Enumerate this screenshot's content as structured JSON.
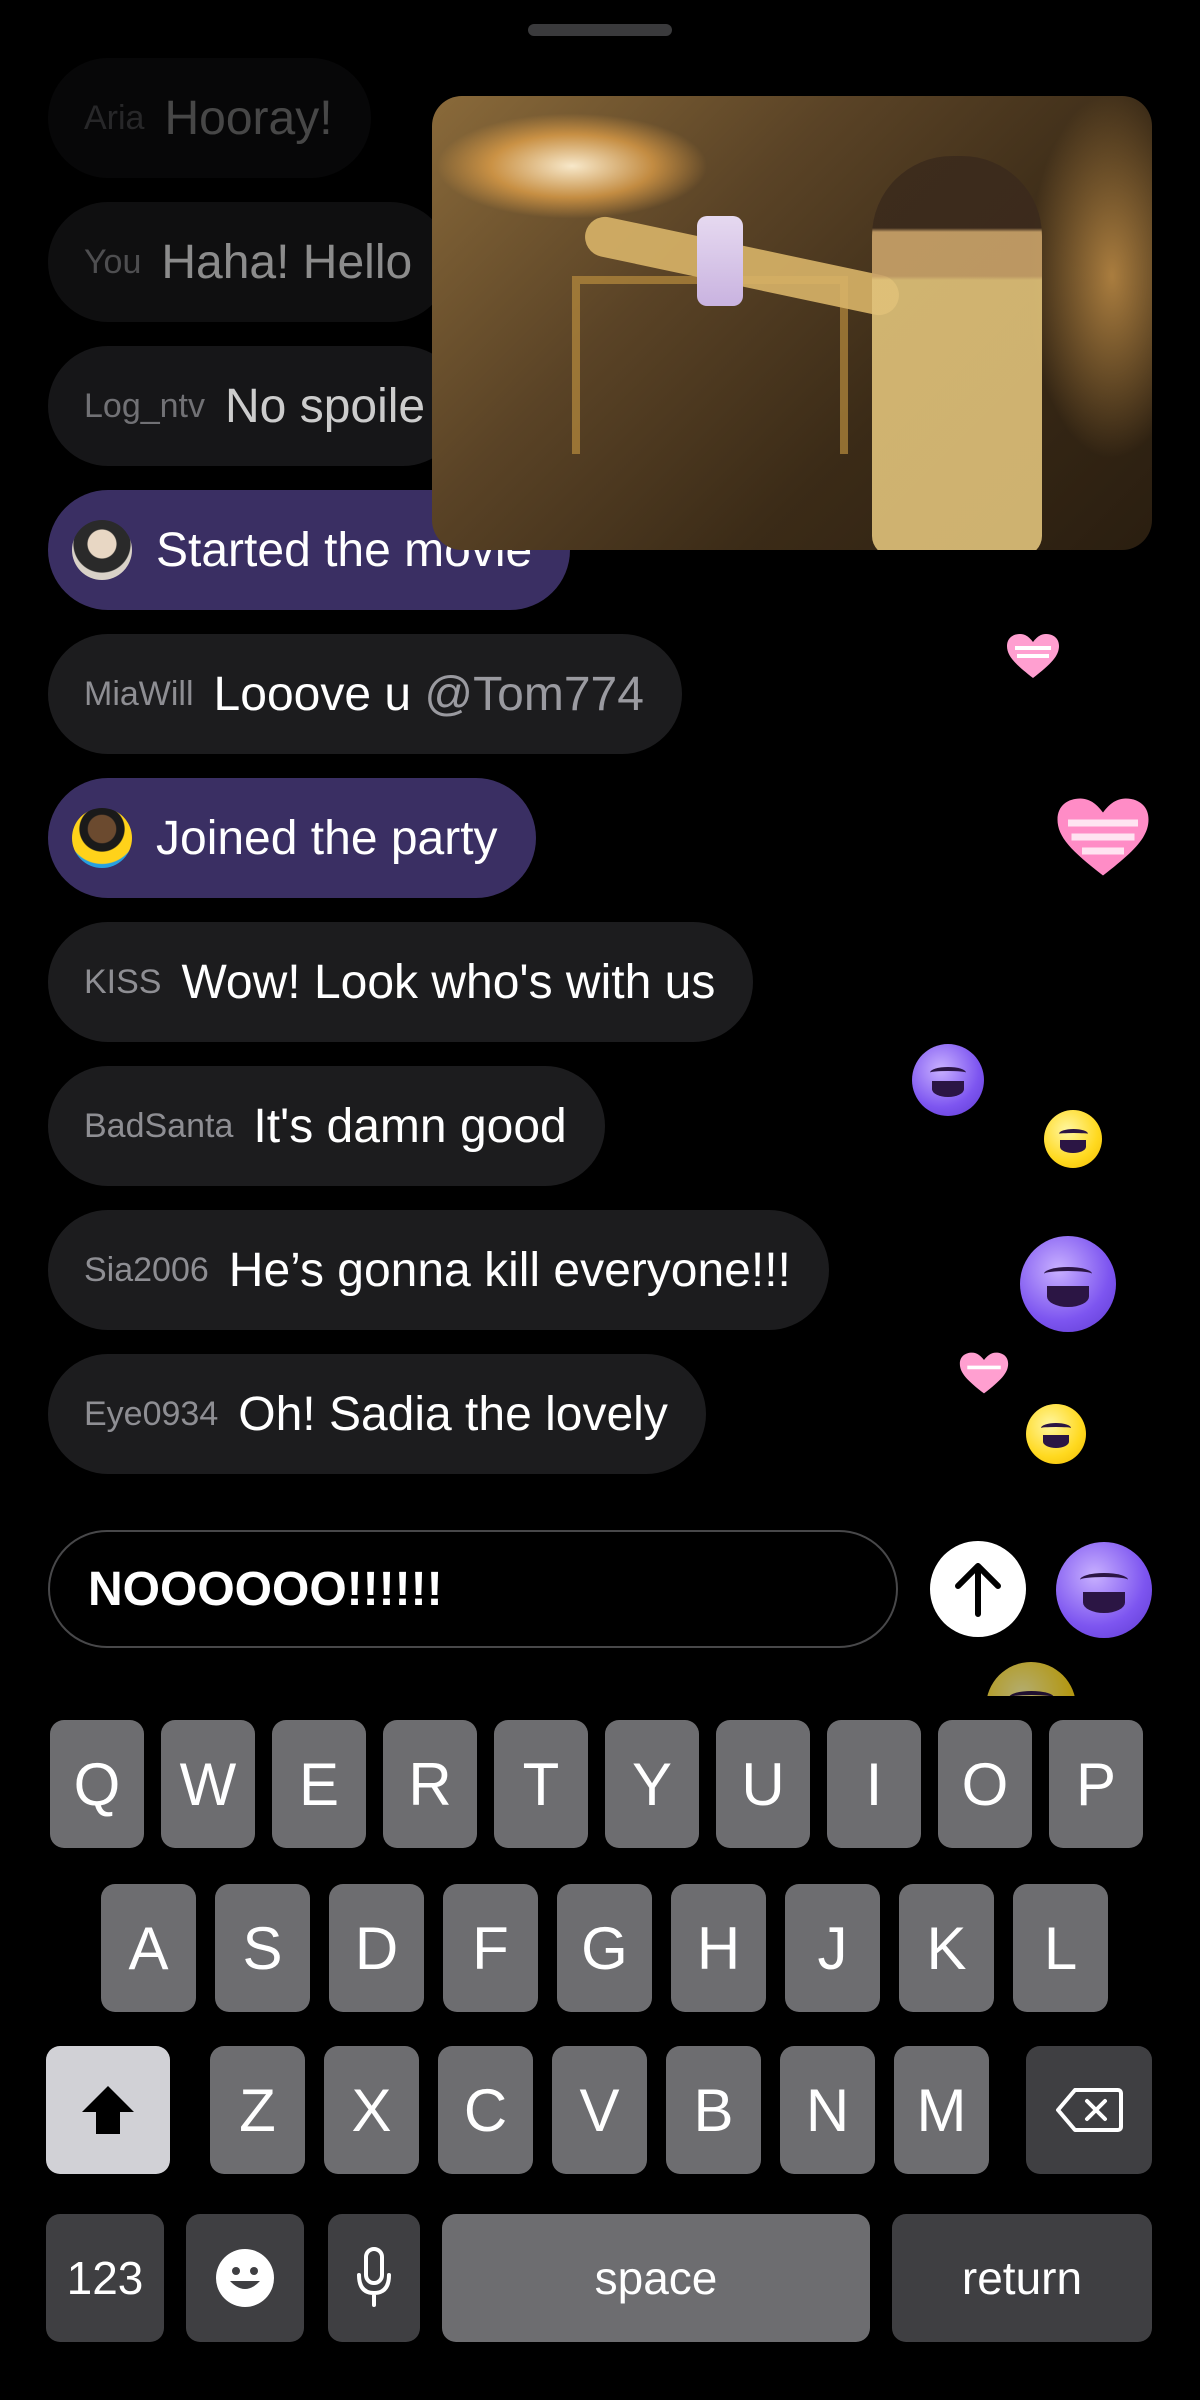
{
  "chat": {
    "messages": [
      {
        "user": "Aria",
        "text": "Hooray!"
      },
      {
        "user": "You",
        "text": "Haha! Hello"
      },
      {
        "user": "Log_ntv",
        "text": "No spoile"
      },
      {
        "user": "",
        "text": "Started the movie",
        "system": true
      },
      {
        "user": "MiaWill",
        "text": "Looove u",
        "mention": "@Tom774"
      },
      {
        "user": "",
        "text": "Joined the party",
        "system": true
      },
      {
        "user": "KISS",
        "text": "Wow! Look who's with us"
      },
      {
        "user": "BadSanta",
        "text": "It's damn good"
      },
      {
        "user": "Sia2006",
        "text": "He’s gonna kill everyone!!!"
      },
      {
        "user": "Eye0934",
        "text": "Oh! Sadia the lovely"
      }
    ]
  },
  "composer": {
    "value": "NOOOOOO!!!!!!"
  },
  "icons": {
    "send": "arrow-up-icon",
    "reaction": "laughing-face-icon",
    "heart": "heart-icon"
  },
  "keyboard": {
    "row1": [
      "Q",
      "W",
      "E",
      "R",
      "T",
      "Y",
      "U",
      "I",
      "O",
      "P"
    ],
    "row2": [
      "A",
      "S",
      "D",
      "F",
      "G",
      "H",
      "J",
      "K",
      "L"
    ],
    "row3": [
      "Z",
      "X",
      "C",
      "V",
      "B",
      "N",
      "M"
    ],
    "numbers_label": "123",
    "space_label": "space",
    "return_label": "return"
  }
}
